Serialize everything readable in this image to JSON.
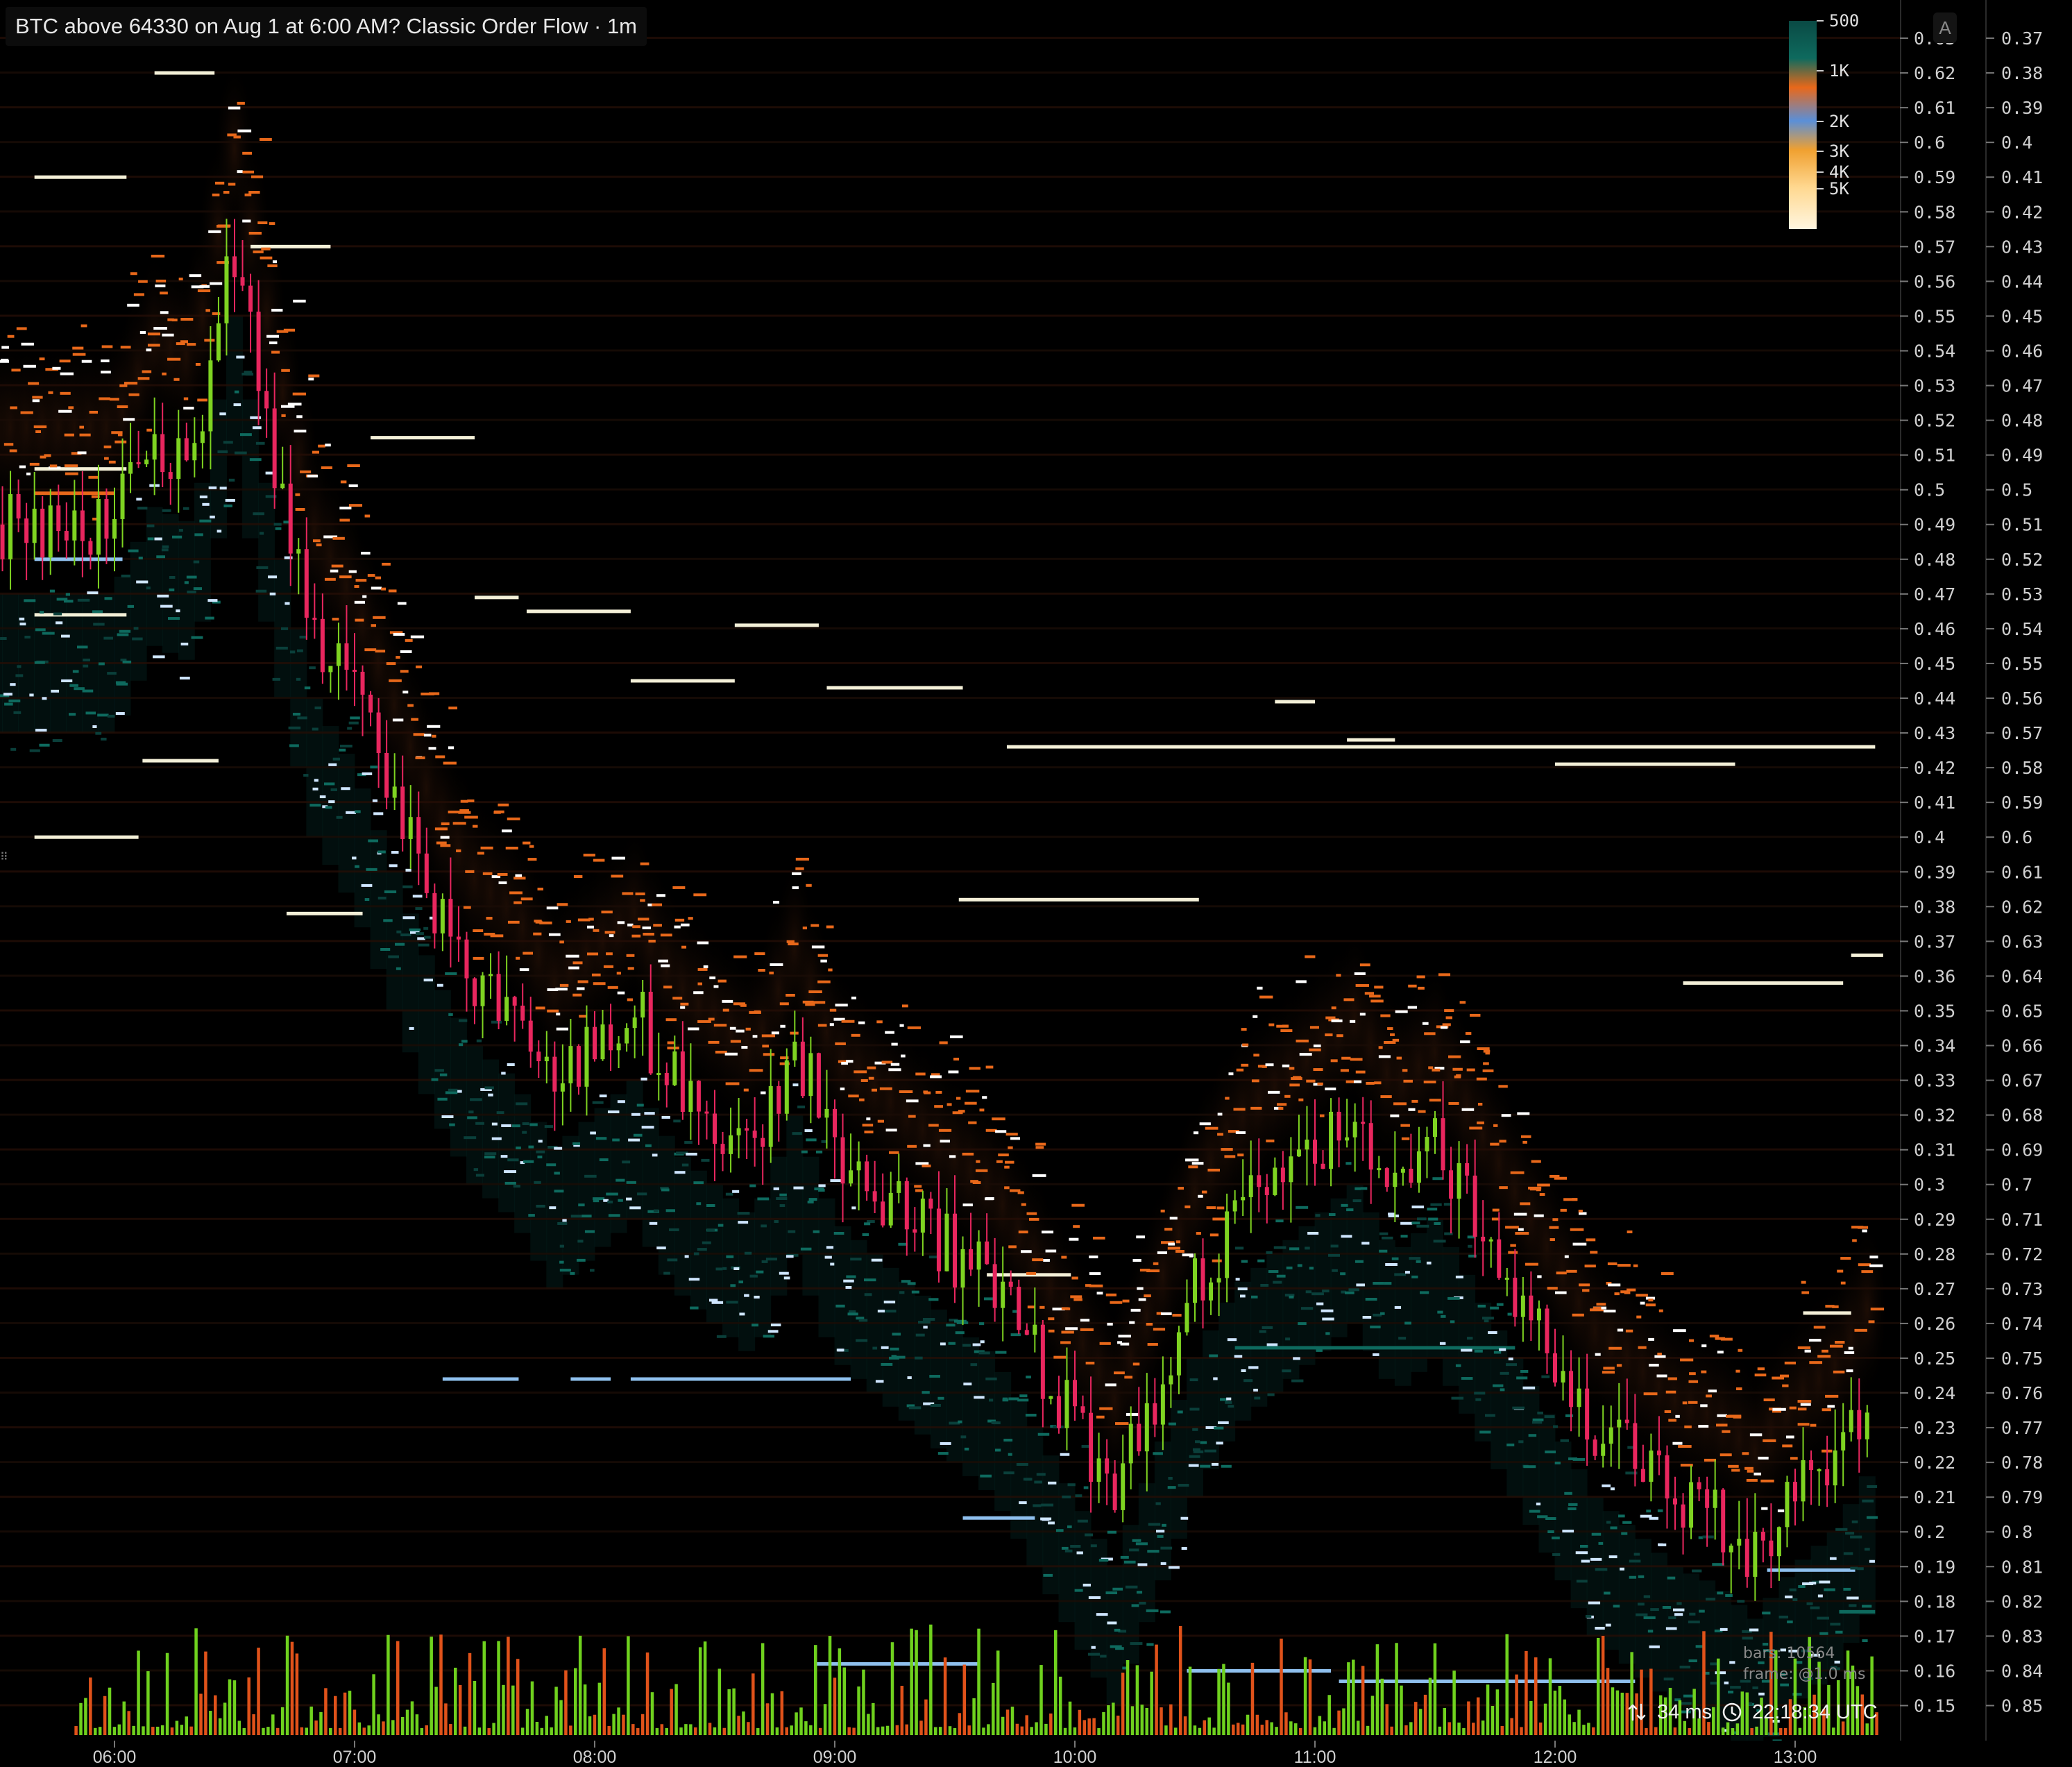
{
  "header": {
    "title": "BTC above 64330 on Aug 1 at 6:00 AM? Classic Order Flow · 1m"
  },
  "stats": {
    "bars": "bars: 10564",
    "frame": "frame: @1.0 ms"
  },
  "status": {
    "latency": "34 ms",
    "time": "22:18:34 UTC"
  },
  "corner_button": {
    "label": "A"
  },
  "handle_glyph": "⠿",
  "colors": {
    "background": "#000000",
    "up": "#7ed321",
    "down": "#e8265e",
    "ask": "#e8681a",
    "bid": "#4a9fd8",
    "heat_low": "#0e5a52",
    "heat_high": "#fff2c8"
  },
  "chart_data": {
    "type": "candlestick",
    "x_ticks": [
      "06:00",
      "07:00",
      "08:00",
      "09:00",
      "10:00",
      "11:00",
      "12:00",
      "13:00"
    ],
    "ylim": [
      0.145,
      0.632
    ],
    "y_left_ticks": [
      "0.63",
      "0.62",
      "0.61",
      "0.6",
      "0.59",
      "0.58",
      "0.57",
      "0.56",
      "0.55",
      "0.54",
      "0.53",
      "0.52",
      "0.51",
      "0.5",
      "0.49",
      "0.48",
      "0.47",
      "0.46",
      "0.45",
      "0.44",
      "0.43",
      "0.42",
      "0.41",
      "0.4",
      "0.39",
      "0.38",
      "0.37",
      "0.36",
      "0.35",
      "0.34",
      "0.33",
      "0.32",
      "0.31",
      "0.3",
      "0.29",
      "0.28",
      "0.27",
      "0.26",
      "0.25",
      "0.24",
      "0.23",
      "0.22",
      "0.21",
      "0.2",
      "0.19",
      "0.18",
      "0.17",
      "0.16",
      "0.15"
    ],
    "y_right_ticks": [
      "0.37",
      "0.38",
      "0.39",
      "0.4",
      "0.41",
      "0.42",
      "0.43",
      "0.44",
      "0.45",
      "0.46",
      "0.47",
      "0.48",
      "0.49",
      "0.5",
      "0.51",
      "0.52",
      "0.53",
      "0.54",
      "0.55",
      "0.56",
      "0.57",
      "0.58",
      "0.59",
      "0.6",
      "0.61",
      "0.62",
      "0.63",
      "0.64",
      "0.65",
      "0.66",
      "0.67",
      "0.68",
      "0.69",
      "0.7",
      "0.71",
      "0.72",
      "0.73",
      "0.74",
      "0.75",
      "0.76",
      "0.77",
      "0.78",
      "0.79",
      "0.8",
      "0.81",
      "0.82",
      "0.83",
      "0.84",
      "0.85"
    ],
    "legend": {
      "position": "top-right",
      "scale_labels": [
        "500",
        "1K",
        "2K",
        "3K",
        "4K",
        "5K"
      ]
    },
    "series_close": {
      "times": [
        "06:00",
        "06:10",
        "06:20",
        "06:30",
        "06:40",
        "06:50",
        "07:00",
        "07:10",
        "07:20",
        "07:30",
        "07:40",
        "07:50",
        "08:00",
        "08:10",
        "08:20",
        "08:30",
        "08:40",
        "08:50",
        "09:00",
        "09:10",
        "09:20",
        "09:30",
        "09:40",
        "09:50",
        "10:00",
        "10:10",
        "10:20",
        "10:30",
        "10:40",
        "10:50",
        "11:00",
        "11:10",
        "11:20",
        "11:30",
        "11:40",
        "11:50",
        "12:00",
        "12:10",
        "12:20",
        "12:30",
        "12:40",
        "12:50",
        "13:00",
        "13:10",
        "13:20"
      ],
      "values": [
        0.49,
        0.515,
        0.51,
        0.57,
        0.51,
        0.46,
        0.44,
        0.41,
        0.38,
        0.36,
        0.35,
        0.33,
        0.34,
        0.35,
        0.33,
        0.32,
        0.31,
        0.34,
        0.31,
        0.3,
        0.29,
        0.28,
        0.27,
        0.25,
        0.23,
        0.21,
        0.24,
        0.27,
        0.29,
        0.3,
        0.31,
        0.32,
        0.3,
        0.31,
        0.29,
        0.27,
        0.25,
        0.23,
        0.22,
        0.21,
        0.205,
        0.195,
        0.21,
        0.22,
        0.24
      ]
    },
    "resting_orders": [
      {
        "price": 0.62,
        "t0": "06:10",
        "t1": "06:25",
        "side": "large"
      },
      {
        "price": 0.59,
        "t0": "05:40",
        "t1": "06:03",
        "side": "large"
      },
      {
        "price": 0.57,
        "t0": "06:34",
        "t1": "06:54",
        "side": "large"
      },
      {
        "price": 0.515,
        "t0": "07:04",
        "t1": "07:30",
        "side": "large"
      },
      {
        "price": 0.506,
        "t0": "05:40",
        "t1": "06:03",
        "side": "large"
      },
      {
        "price": 0.499,
        "t0": "05:40",
        "t1": "06:00",
        "side": "ask"
      },
      {
        "price": 0.48,
        "t0": "05:40",
        "t1": "06:02",
        "side": "bid"
      },
      {
        "price": 0.464,
        "t0": "05:40",
        "t1": "06:03",
        "side": "large"
      },
      {
        "price": 0.469,
        "t0": "07:30",
        "t1": "07:41",
        "side": "large"
      },
      {
        "price": 0.465,
        "t0": "07:43",
        "t1": "08:09",
        "side": "large"
      },
      {
        "price": 0.461,
        "t0": "08:35",
        "t1": "08:56",
        "side": "large"
      },
      {
        "price": 0.445,
        "t0": "08:09",
        "t1": "08:35",
        "side": "large"
      },
      {
        "price": 0.443,
        "t0": "08:58",
        "t1": "09:32",
        "side": "large"
      },
      {
        "price": 0.439,
        "t0": "10:50",
        "t1": "11:00",
        "side": "large"
      },
      {
        "price": 0.426,
        "t0": "09:43",
        "t1": "13:20",
        "side": "large"
      },
      {
        "price": 0.428,
        "t0": "11:08",
        "t1": "11:20",
        "side": "large"
      },
      {
        "price": 0.421,
        "t0": "12:00",
        "t1": "12:45",
        "side": "large"
      },
      {
        "price": 0.422,
        "t0": "06:07",
        "t1": "06:26",
        "side": "large"
      },
      {
        "price": 0.4,
        "t0": "05:40",
        "t1": "06:06",
        "side": "large"
      },
      {
        "price": 0.382,
        "t0": "09:31",
        "t1": "10:31",
        "side": "large"
      },
      {
        "price": 0.378,
        "t0": "06:43",
        "t1": "07:02",
        "side": "large"
      },
      {
        "price": 0.358,
        "t0": "12:32",
        "t1": "13:12",
        "side": "large"
      },
      {
        "price": 0.366,
        "t0": "13:14",
        "t1": "13:22",
        "side": "large"
      },
      {
        "price": 0.244,
        "t0": "07:22",
        "t1": "07:41",
        "side": "bid"
      },
      {
        "price": 0.244,
        "t0": "07:54",
        "t1": "08:04",
        "side": "bid"
      },
      {
        "price": 0.244,
        "t0": "08:09",
        "t1": "09:04",
        "side": "bid"
      },
      {
        "price": 0.274,
        "t0": "09:38",
        "t1": "09:59",
        "side": "large"
      },
      {
        "price": 0.263,
        "t0": "13:02",
        "t1": "13:14",
        "side": "large"
      },
      {
        "price": 0.253,
        "t0": "10:40",
        "t1": "11:50",
        "side": "heat"
      },
      {
        "price": 0.204,
        "t0": "09:32",
        "t1": "09:50",
        "side": "bid"
      },
      {
        "price": 0.177,
        "t0": "13:11",
        "t1": "13:20",
        "side": "heat"
      },
      {
        "price": 0.162,
        "t0": "08:55",
        "t1": "09:36",
        "side": "bid"
      },
      {
        "price": 0.16,
        "t0": "10:28",
        "t1": "11:04",
        "side": "bid"
      },
      {
        "price": 0.157,
        "t0": "11:06",
        "t1": "12:20",
        "side": "bid"
      },
      {
        "price": 0.189,
        "t0": "12:53",
        "t1": "13:15",
        "side": "bid"
      }
    ],
    "volume": {
      "max": 1,
      "note": "green = buy volume, orange = sell volume"
    }
  }
}
